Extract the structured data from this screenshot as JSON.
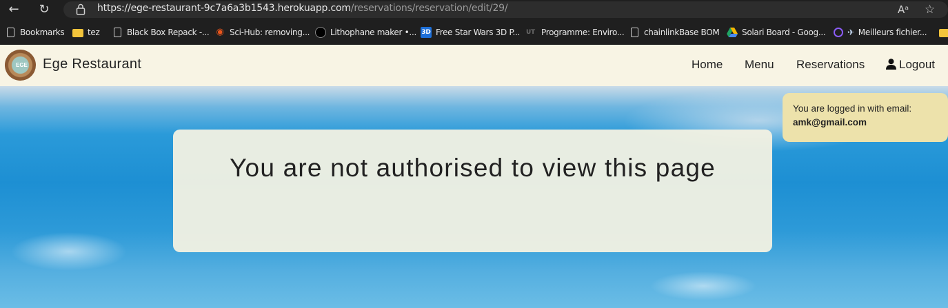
{
  "browser": {
    "url_host": "https://ege-restaurant-9c7a6a3b1543.herokuapp.com",
    "url_path": "/reservations/reservation/edit/29/",
    "bookmarks": [
      {
        "label": "Bookmarks",
        "icon": "page-icon"
      },
      {
        "label": "tez",
        "icon": "folder-icon"
      },
      {
        "label": "Black Box Repack -...",
        "icon": "page-icon"
      },
      {
        "label": "Sci-Hub: removing...",
        "icon": "sci-hub-icon"
      },
      {
        "label": "Lithophane maker •...",
        "icon": "lithophane-icon"
      },
      {
        "label": "Free Star Wars 3D P...",
        "icon": "3d-icon"
      },
      {
        "label": "Programme: Enviro...",
        "icon": "ut-icon"
      },
      {
        "label": "chainlinkBase BOM",
        "icon": "page-icon"
      },
      {
        "label": "Solari Board - Goog...",
        "icon": "google-drive-icon"
      },
      {
        "label": "Meilleurs fichier...",
        "icon": "plane-icon"
      }
    ]
  },
  "site": {
    "brand": "Ege Restaurant",
    "logo_text": "EGE",
    "nav": {
      "home": "Home",
      "menu": "Menu",
      "reservations": "Reservations",
      "logout": "Logout"
    },
    "login_status": {
      "label": "You are logged in with email:",
      "email": "amk@gmail.com"
    },
    "message": "You are not authorised to view this page"
  }
}
